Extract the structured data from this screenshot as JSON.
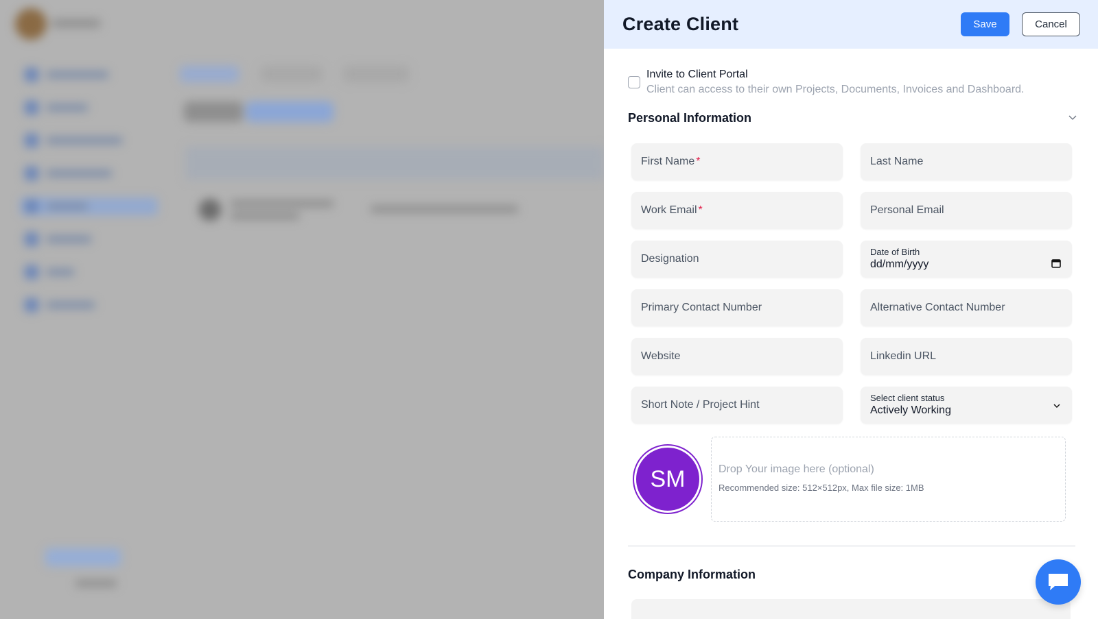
{
  "drawer": {
    "title": "Create Client",
    "save_label": "Save",
    "cancel_label": "Cancel"
  },
  "invite": {
    "label": "Invite to Client Portal",
    "description": "Client can access to their own Projects, Documents, Invoices and Dashboard.",
    "checked": false
  },
  "personal": {
    "title": "Personal Information",
    "first_name": "First Name",
    "last_name": "Last Name",
    "work_email": "Work Email",
    "personal_email": "Personal Email",
    "designation": "Designation",
    "dob_label": "Date of Birth",
    "dob_value": "dd/mm/yyyy",
    "primary_contact": "Primary Contact Number",
    "alternative_contact": "Alternative Contact Number",
    "website": "Website",
    "linkedin": "Linkedin URL",
    "short_note": "Short Note / Project Hint",
    "status_label": "Select client status",
    "status_value": "Actively Working",
    "required_mark": "*"
  },
  "avatar": {
    "initials": "SM",
    "color": "#7e22ce"
  },
  "dropzone": {
    "title": "Drop Your image here (optional)",
    "hint": "Recommended size: 512×512px, Max file size: 1MB"
  },
  "company": {
    "title": "Company Information"
  },
  "colors": {
    "accent": "#2f7bf6",
    "header_bg": "#e6efff",
    "required": "#e11d48"
  }
}
